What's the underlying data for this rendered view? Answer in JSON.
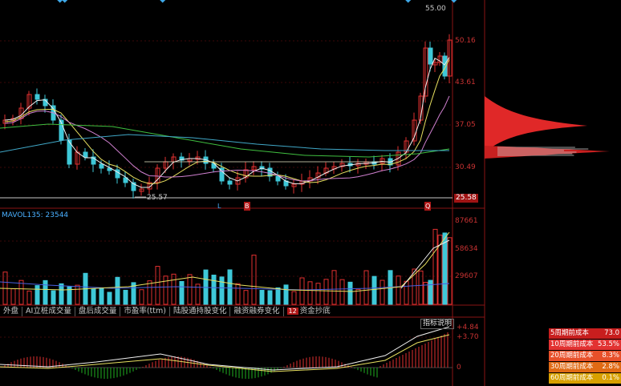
{
  "price_axis": [
    "55.00",
    "50.16",
    "43.61",
    "37.05",
    "30.49",
    "25.58"
  ],
  "low_marker": "25.57",
  "volume": {
    "title": "MAVOL135: 23544",
    "axis": [
      "87661",
      "58634",
      "29607"
    ]
  },
  "markers": {
    "l": "L",
    "b": "B",
    "q": "Q"
  },
  "tabs": [
    {
      "label": "外盘",
      "num": ""
    },
    {
      "label": "AI立桩成交量",
      "num": ""
    },
    {
      "label": "盘后成交量",
      "num": ""
    },
    {
      "label": "市盈率(ttm)",
      "num": ""
    },
    {
      "label": "陆股通持股变化",
      "num": ""
    },
    {
      "label": "融资融券变化",
      "num": ""
    },
    {
      "label": "资金抄底",
      "num": "12"
    }
  ],
  "indicator": {
    "button": "指标说明",
    "axis": [
      "+4.84",
      "+3.70",
      "0"
    ]
  },
  "cost_legend": [
    {
      "label": "5周期前成本",
      "value": "73.0",
      "color": "#c81e1e"
    },
    {
      "label": "10周期前成本",
      "value": "53.5%",
      "color": "#e23232"
    },
    {
      "label": "20周期前成本",
      "value": "8.3%",
      "color": "#e8502a"
    },
    {
      "label": "30周期前成本",
      "value": "2.8%",
      "color": "#e06a14"
    },
    {
      "label": "60周期前成本",
      "value": "0.1%",
      "color": "#d8a000"
    }
  ],
  "colors": {
    "up": "#e03030",
    "down": "#3ec8d8",
    "ma5": "#f0f0f0",
    "ma10": "#e8e060",
    "ma20": "#d080d0",
    "ma60": "#40c040",
    "ma120": "#40a8c8",
    "grid": "#7a1010"
  }
}
